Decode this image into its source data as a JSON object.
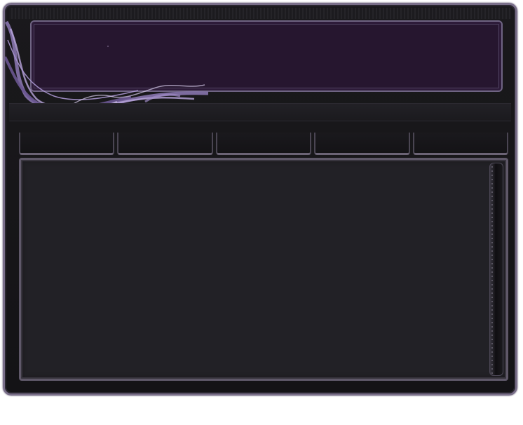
{
  "window": {
    "title": ""
  },
  "header": {
    "title": ""
  },
  "tabs": [
    {
      "label": ""
    },
    {
      "label": ""
    },
    {
      "label": ""
    },
    {
      "label": ""
    },
    {
      "label": ""
    }
  ],
  "content": {
    "text": ""
  },
  "colors": {
    "frame_border": "#7a6f8a",
    "banner_fill": "#26162f",
    "panel_fill": "#222126",
    "vine": "#8e7ab5"
  },
  "icons": {
    "decoration": "purple-vine-ornament"
  }
}
